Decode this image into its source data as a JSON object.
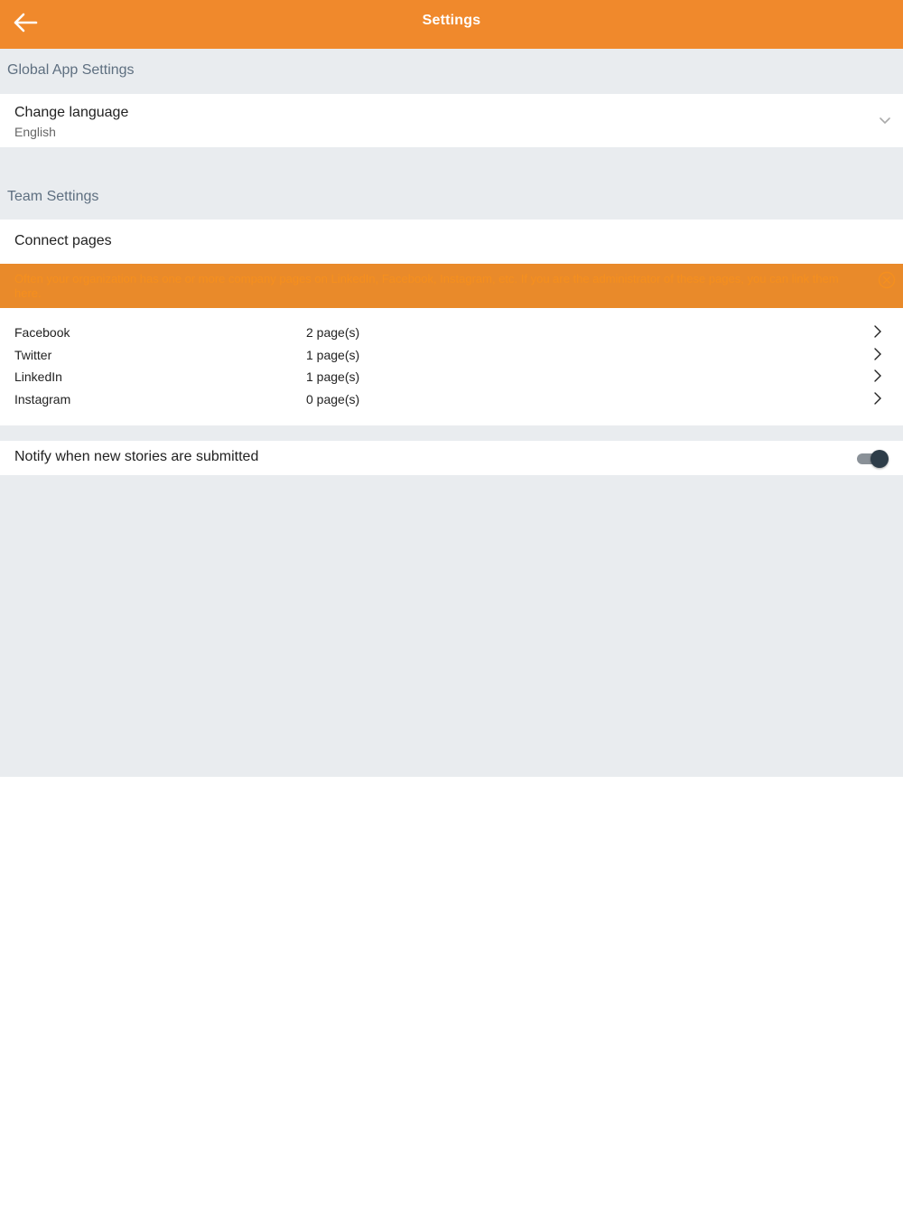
{
  "header": {
    "title": "Settings",
    "back_icon": "arrow-left-icon"
  },
  "global_section": {
    "title": "Global App Settings",
    "language": {
      "label": "Change language",
      "value": "English"
    }
  },
  "team_section": {
    "title": "Team Settings",
    "connect_pages": {
      "label": "Connect pages"
    },
    "banner": {
      "text": "Often your organization has one or more company pages on LinkedIn, Facebook, Instagram, etc. If you are the administrator of these pages, you can link them here.",
      "background": "#e98a2a"
    },
    "pages": [
      {
        "name": "Facebook",
        "count": "2 page(s)"
      },
      {
        "name": "Twitter",
        "count": "1 page(s)"
      },
      {
        "name": "LinkedIn",
        "count": "1 page(s)"
      },
      {
        "name": "Instagram",
        "count": "0 page(s)"
      }
    ],
    "notify": {
      "label": "Notify when new stories are submitted",
      "enabled": true
    }
  },
  "colors": {
    "accent": "#f0892c",
    "section_text": "#5e6f80",
    "background": "#e9ecef"
  }
}
